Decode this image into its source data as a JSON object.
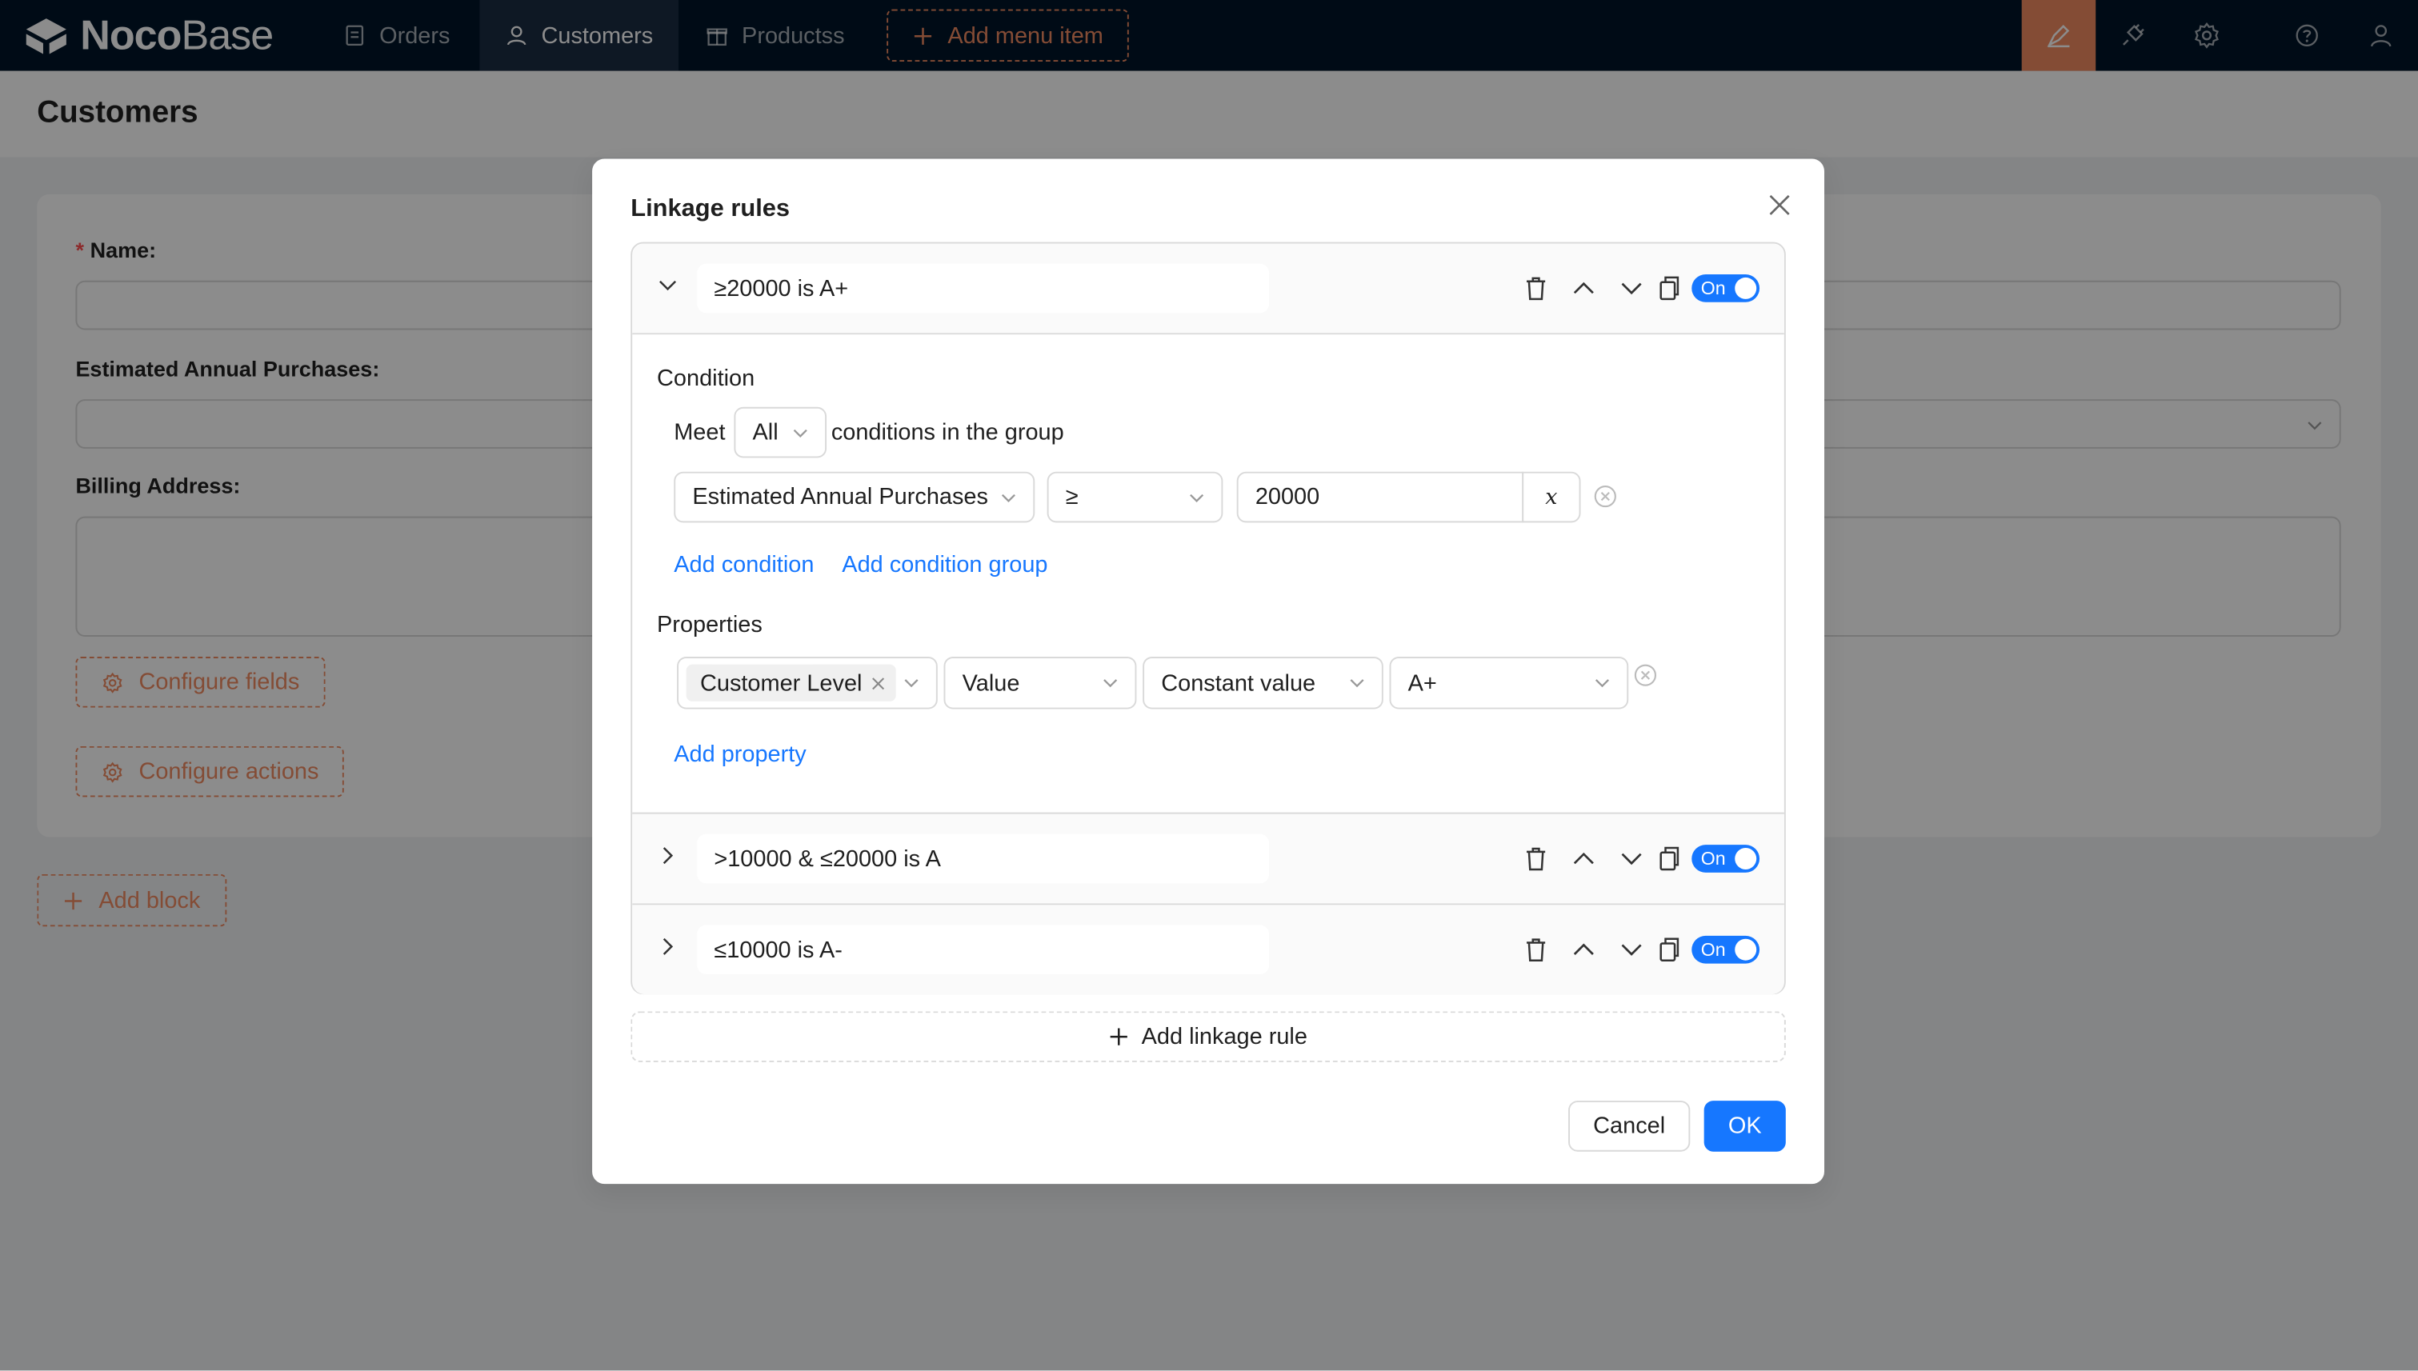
{
  "app": {
    "logo_bold": "Noco",
    "logo_light": "Base",
    "nav": [
      {
        "label": "Orders",
        "icon": "file-icon"
      },
      {
        "label": "Customers",
        "icon": "user-icon",
        "active": true
      },
      {
        "label": "Productss",
        "icon": "gift-icon"
      }
    ],
    "add_menu_item": "Add menu item",
    "right_icons": [
      "design-pen-icon",
      "plugin-icon",
      "gear-icon",
      "help-icon",
      "user-icon"
    ],
    "accent_color": "#f18b62",
    "nav_background": "#001529"
  },
  "page": {
    "title": "Customers",
    "form": {
      "name_label": "Name",
      "name_required": "*",
      "estimated_label": "Estimated Annual Purchases",
      "billing_label": "Billing Address",
      "label_colon": ":",
      "configure_fields": "Configure fields",
      "configure_actions": "Configure actions"
    },
    "add_block": "Add block"
  },
  "modal": {
    "title": "Linkage rules",
    "rules": [
      {
        "name": "≥20000 is A+",
        "expanded": true,
        "toggle": "On"
      },
      {
        "name": ">10000 & ≤20000 is A",
        "expanded": false,
        "toggle": "On"
      },
      {
        "name": "≤10000 is A-",
        "expanded": false,
        "toggle": "On"
      }
    ],
    "condition": {
      "section_title": "Condition",
      "meet_prefix": "Meet",
      "meet_value": "All",
      "meet_suffix": "conditions in the group",
      "field": "Estimated Annual Purchases",
      "operator": "≥",
      "value": "20000",
      "variable_button": "x",
      "add_condition": "Add condition",
      "add_condition_group": "Add condition group"
    },
    "properties": {
      "section_title": "Properties",
      "field_tag": "Customer Level",
      "property": "Value",
      "value_type": "Constant value",
      "value": "A+",
      "add_property": "Add property"
    },
    "add_linkage_rule": "Add linkage rule",
    "cancel": "Cancel",
    "ok": "OK",
    "primary_color": "#1677ff"
  }
}
